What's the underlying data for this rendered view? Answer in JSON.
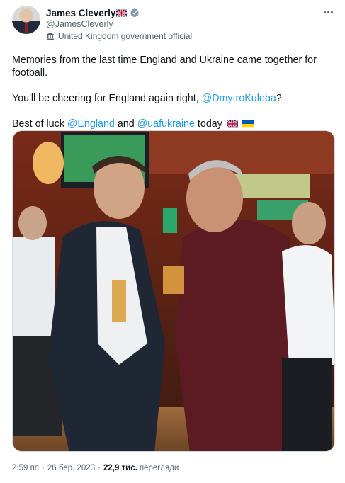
{
  "author": {
    "display_name": "James Cleverly",
    "handle": "@JamesCleverly",
    "label": "United Kingdom government official"
  },
  "tweet": {
    "line1": "Memories from the last time England and Ukraine came together for football.",
    "line2_prefix": "You'll be cheering for England again right, ",
    "line2_mention": "@DmytroKuleba",
    "line2_suffix": "?",
    "line3_prefix": "Best of luck ",
    "line3_mention1": "@England",
    "line3_middle": " and ",
    "line3_mention2": "@uafukraine",
    "line3_suffix": " today"
  },
  "meta": {
    "time": "2:59 пп",
    "separator": "·",
    "date": "26 бер. 2023",
    "views_count": "22,9 тис.",
    "views_label": "перегляди"
  },
  "icons": {
    "verified": "verified-badge-icon",
    "gov": "government-building-icon",
    "more": "more-options-icon",
    "flag_uk": "uk-flag-icon",
    "flag_ua": "ukraine-flag-icon"
  },
  "colors": {
    "link": "#1d9bf0",
    "secondary_text": "#536471",
    "primary_text": "#0f1419"
  }
}
